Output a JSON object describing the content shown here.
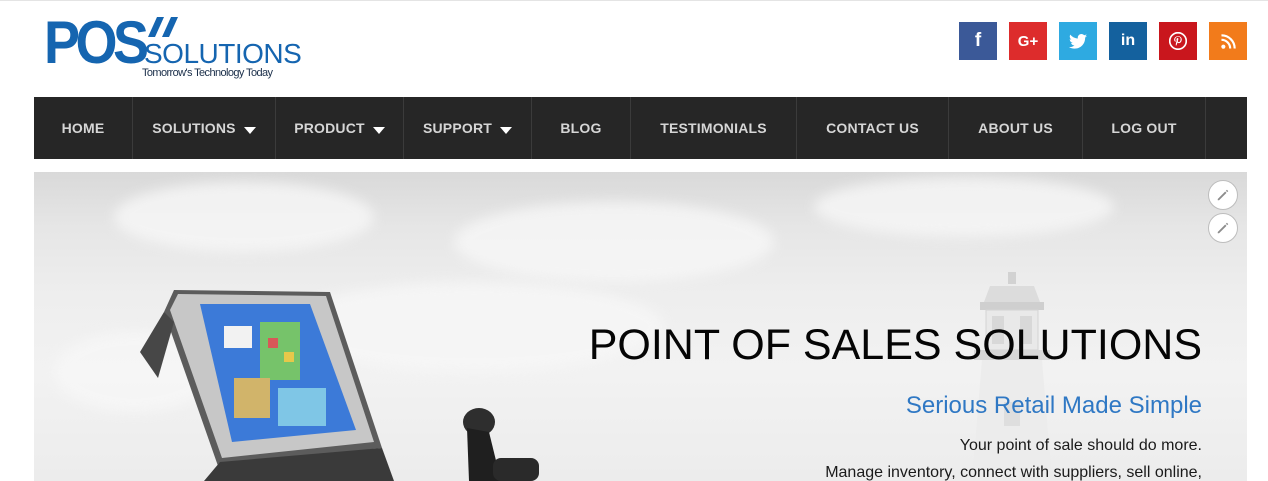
{
  "brand": {
    "logo_main": "POS",
    "logo_secondary": "SOLUTIONS",
    "tagline": "Tomorrow's Technology Today",
    "color_primary": "#1565b0"
  },
  "social": [
    {
      "name": "facebook",
      "icon": "facebook-icon",
      "glyph": "f",
      "color": "#3b5998"
    },
    {
      "name": "google-plus",
      "icon": "google-plus-icon",
      "glyph": "G+",
      "color": "#dd2c2c"
    },
    {
      "name": "twitter",
      "icon": "twitter-icon",
      "glyph": "",
      "color": "#2eaae1"
    },
    {
      "name": "linkedin",
      "icon": "linkedin-icon",
      "glyph": "in",
      "color": "#14619e"
    },
    {
      "name": "pinterest",
      "icon": "pinterest-icon",
      "glyph": "P",
      "color": "#c9161d"
    },
    {
      "name": "rss",
      "icon": "rss-icon",
      "glyph": "",
      "color": "#f27b1b"
    }
  ],
  "nav": {
    "items": [
      {
        "label": "HOME",
        "dropdown": false
      },
      {
        "label": "SOLUTIONS",
        "dropdown": true
      },
      {
        "label": "PRODUCT",
        "dropdown": true
      },
      {
        "label": "SUPPORT",
        "dropdown": true
      },
      {
        "label": "BLOG",
        "dropdown": false
      },
      {
        "label": "TESTIMONIALS",
        "dropdown": false
      },
      {
        "label": "CONTACT US",
        "dropdown": false
      },
      {
        "label": "ABOUT US",
        "dropdown": false
      },
      {
        "label": "LOG OUT",
        "dropdown": false
      }
    ],
    "background": "#262626"
  },
  "hero": {
    "title": "POINT OF SALES SOLUTIONS",
    "subtitle": "Serious Retail Made Simple",
    "lines": [
      "Your point of sale should do more.",
      "Manage inventory, connect with suppliers, sell online,"
    ],
    "subtitle_color": "#2f78c4"
  }
}
